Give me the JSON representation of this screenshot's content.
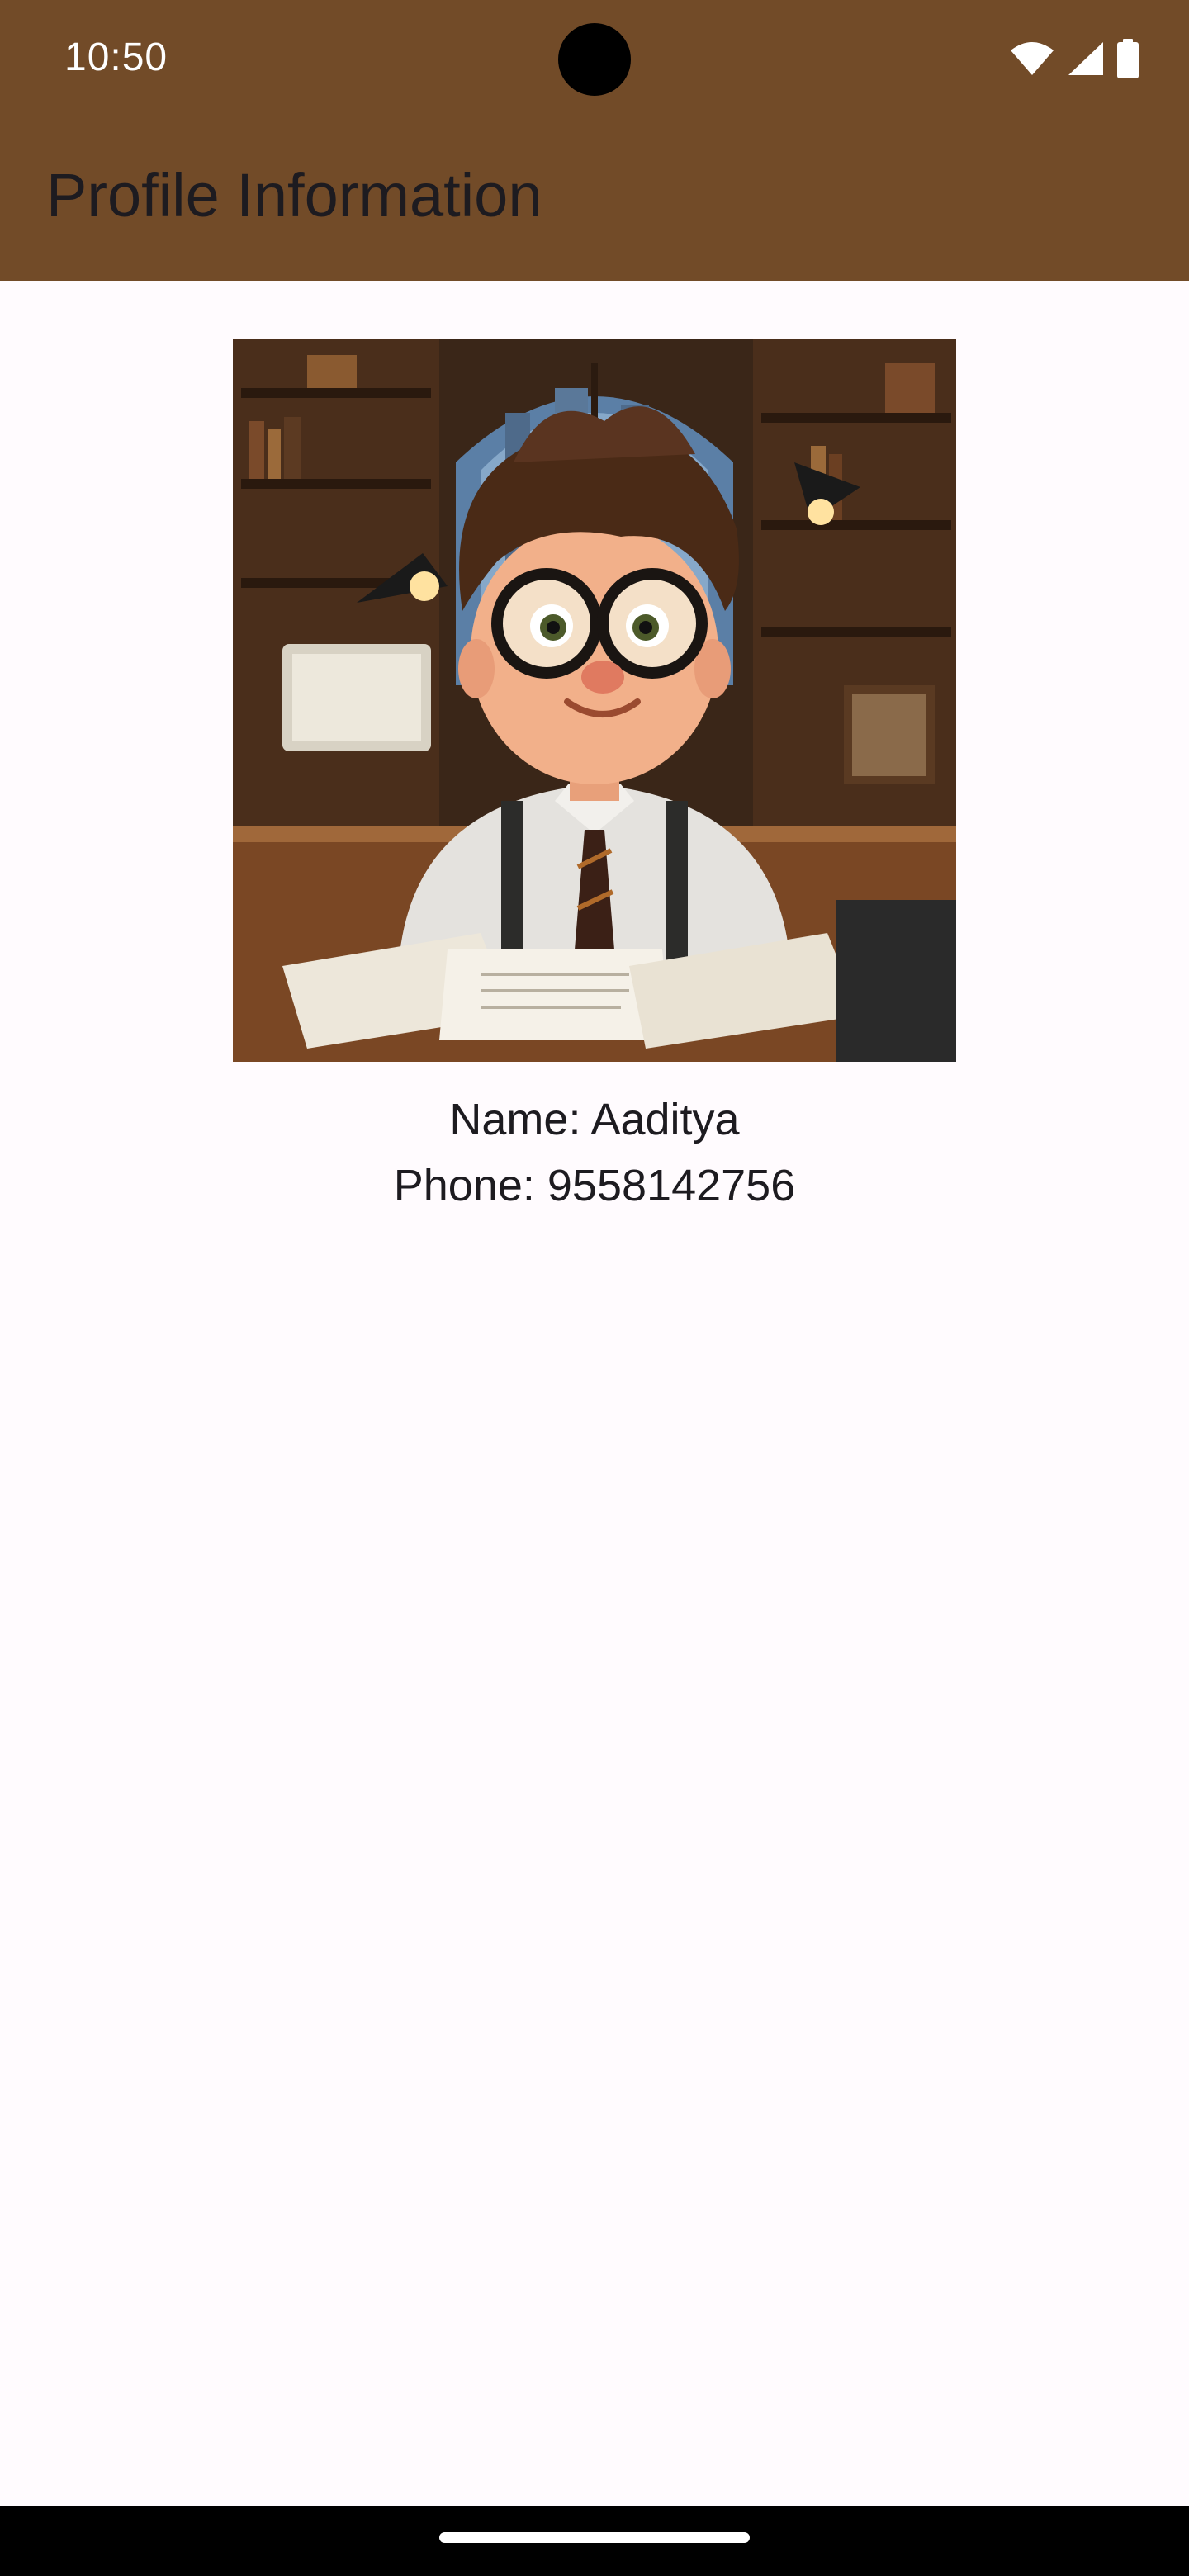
{
  "status_bar": {
    "time": "10:50",
    "icons": [
      "wifi-icon",
      "signal-icon",
      "battery-icon"
    ]
  },
  "app_bar": {
    "title": "Profile Information"
  },
  "profile": {
    "image_icon": "cartoon-profile-picture",
    "name_line": "Name: Aaditya",
    "phone_line": "Phone: 9558142756"
  },
  "colors": {
    "app_bar": "#724B28",
    "background": "#FFFBFE",
    "text": "#1D1B20"
  }
}
